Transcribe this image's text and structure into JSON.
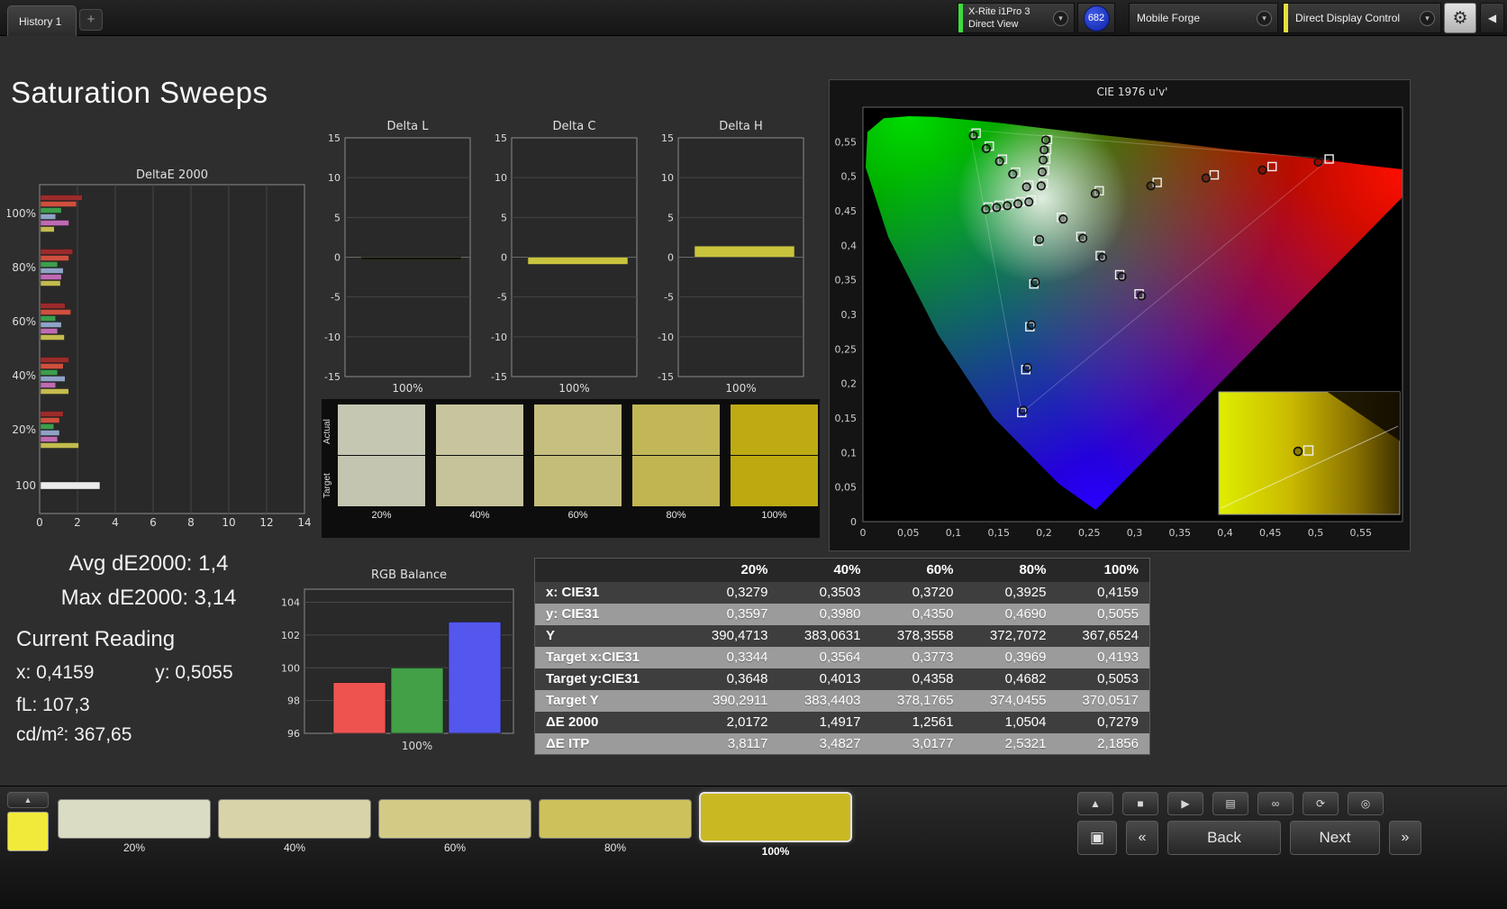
{
  "topbar": {
    "tab": "History 1",
    "add_tab": "+",
    "meter_device": {
      "line1": "X-Rite i1Pro 3",
      "line2": "Direct View",
      "accent": "#3ddc3d"
    },
    "reading_count": "682",
    "source_device": "Mobile Forge",
    "control_device": {
      "label": "Direct Display Control",
      "accent": "#e6e03c"
    },
    "gear_icon": "⚙",
    "collapse_icon": "◀"
  },
  "page_title": "Saturation Sweeps",
  "stats": {
    "avg": "Avg dE2000: 1,4",
    "max": "Max dE2000: 3,14",
    "current_reading": "Current Reading",
    "x": "x: 0,4159",
    "y": "y: 0,5055",
    "fl": "fL: 107,3",
    "luminance": "cd/m²: 367,65"
  },
  "swatch_strip": {
    "row_labels": [
      "Actual",
      "Target"
    ],
    "columns": [
      {
        "label": "20%",
        "actual": "#c6c7b3",
        "target": "#c4c5b0"
      },
      {
        "label": "40%",
        "actual": "#c8c59e",
        "target": "#c6c39a"
      },
      {
        "label": "60%",
        "actual": "#c6bf7f",
        "target": "#c4bd7a"
      },
      {
        "label": "80%",
        "actual": "#c2b757",
        "target": "#c0b551"
      },
      {
        "label": "100%",
        "actual": "#beab14",
        "target": "#bcaa10"
      }
    ]
  },
  "table": {
    "columns": [
      "20%",
      "40%",
      "60%",
      "80%",
      "100%"
    ],
    "rows": [
      {
        "label": "x: CIE31",
        "values": [
          "0,3279",
          "0,3503",
          "0,3720",
          "0,3925",
          "0,4159"
        ]
      },
      {
        "label": "y: CIE31",
        "values": [
          "0,3597",
          "0,3980",
          "0,4350",
          "0,4690",
          "0,5055"
        ]
      },
      {
        "label": "Y",
        "values": [
          "390,4713",
          "383,0631",
          "378,3558",
          "372,7072",
          "367,6524"
        ]
      },
      {
        "label": "Target x:CIE31",
        "values": [
          "0,3344",
          "0,3564",
          "0,3773",
          "0,3969",
          "0,4193"
        ]
      },
      {
        "label": "Target y:CIE31",
        "values": [
          "0,3648",
          "0,4013",
          "0,4358",
          "0,4682",
          "0,5053"
        ]
      },
      {
        "label": "Target Y",
        "values": [
          "390,2911",
          "383,4403",
          "378,1765",
          "374,0455",
          "370,0517"
        ]
      },
      {
        "label": "ΔE 2000",
        "values": [
          "2,0172",
          "1,4917",
          "1,2561",
          "1,0504",
          "0,7279"
        ]
      },
      {
        "label": "ΔE ITP",
        "values": [
          "3,8117",
          "3,4827",
          "3,0177",
          "2,5321",
          "2,1856"
        ]
      }
    ]
  },
  "bottombar": {
    "color_button": "#f2ea3a",
    "up_icon": "▲",
    "swatches": [
      {
        "label": "20%",
        "color": "#dadcc3",
        "selected": false
      },
      {
        "label": "40%",
        "color": "#d8d4a7",
        "selected": false
      },
      {
        "label": "60%",
        "color": "#d3cb85",
        "selected": false
      },
      {
        "label": "80%",
        "color": "#cdc15b",
        "selected": false
      },
      {
        "label": "100%",
        "color": "#cab823",
        "selected": true
      }
    ],
    "transport": [
      {
        "name": "stop",
        "icon": "■"
      },
      {
        "name": "play",
        "icon": "▶"
      },
      {
        "name": "readings-view",
        "icon": "▤"
      },
      {
        "name": "continuous-read",
        "icon": "∞"
      },
      {
        "name": "repeat",
        "icon": "⟳"
      },
      {
        "name": "capture",
        "icon": "◎"
      }
    ],
    "frame_icon": "▣",
    "back_chevron": "«",
    "back": "Back",
    "next": "Next",
    "next_chevron": "»"
  },
  "chart_data": [
    {
      "id": "deltae2000",
      "type": "bar",
      "orientation": "horizontal",
      "title": "DeltaE 2000",
      "xlim": [
        0,
        14
      ],
      "xticks": [
        0,
        2,
        4,
        6,
        8,
        10,
        12,
        14
      ],
      "groups": [
        {
          "label": "100%",
          "bars": [
            {
              "color": "#9c2b2b",
              "value": 2.2
            },
            {
              "color": "#cf4f3e",
              "value": 1.9
            },
            {
              "color": "#3c9e4d",
              "value": 1.1
            },
            {
              "color": "#8fa3c7",
              "value": 0.8
            },
            {
              "color": "#c06ab4",
              "value": 1.5
            },
            {
              "color": "#c3bb4e",
              "value": 0.73
            }
          ]
        },
        {
          "label": "80%",
          "bars": [
            {
              "color": "#9c2b2b",
              "value": 1.7
            },
            {
              "color": "#cf4f3e",
              "value": 1.5
            },
            {
              "color": "#3c9e4d",
              "value": 0.9
            },
            {
              "color": "#8fa3c7",
              "value": 1.2
            },
            {
              "color": "#c06ab4",
              "value": 1.1
            },
            {
              "color": "#c3bb4e",
              "value": 1.05
            }
          ]
        },
        {
          "label": "60%",
          "bars": [
            {
              "color": "#9c2b2b",
              "value": 1.3
            },
            {
              "color": "#cf4f3e",
              "value": 1.6
            },
            {
              "color": "#3c9e4d",
              "value": 0.8
            },
            {
              "color": "#8fa3c7",
              "value": 1.1
            },
            {
              "color": "#c06ab4",
              "value": 0.9
            },
            {
              "color": "#c3bb4e",
              "value": 1.26
            }
          ]
        },
        {
          "label": "40%",
          "bars": [
            {
              "color": "#9c2b2b",
              "value": 1.5
            },
            {
              "color": "#cf4f3e",
              "value": 1.2
            },
            {
              "color": "#3c9e4d",
              "value": 0.9
            },
            {
              "color": "#8fa3c7",
              "value": 1.3
            },
            {
              "color": "#c06ab4",
              "value": 0.8
            },
            {
              "color": "#c3bb4e",
              "value": 1.49
            }
          ]
        },
        {
          "label": "20%",
          "bars": [
            {
              "color": "#9c2b2b",
              "value": 1.2
            },
            {
              "color": "#cf4f3e",
              "value": 1.0
            },
            {
              "color": "#3c9e4d",
              "value": 0.7
            },
            {
              "color": "#8fa3c7",
              "value": 1.0
            },
            {
              "color": "#c06ab4",
              "value": 0.9
            },
            {
              "color": "#c3bb4e",
              "value": 2.02
            }
          ]
        },
        {
          "label": "100",
          "bars": [
            {
              "color": "#ececec",
              "value": 3.14
            }
          ]
        }
      ]
    },
    {
      "id": "delta_l",
      "type": "bar",
      "title": "Delta L",
      "ylim": [
        -15,
        15
      ],
      "yticks": [
        15,
        10,
        5,
        0,
        -5,
        -10,
        -15
      ],
      "categories": [
        "100%"
      ],
      "values": [
        -0.35
      ],
      "bar_color": "#14140a"
    },
    {
      "id": "delta_c",
      "type": "bar",
      "title": "Delta C",
      "ylim": [
        -15,
        15
      ],
      "yticks": [
        15,
        10,
        5,
        0,
        -5,
        -10,
        -15
      ],
      "categories": [
        "100%"
      ],
      "values": [
        -0.9
      ],
      "bar_color": "#c9c43d"
    },
    {
      "id": "delta_h",
      "type": "bar",
      "title": "Delta H",
      "ylim": [
        -15,
        15
      ],
      "yticks": [
        15,
        10,
        5,
        0,
        -5,
        -10,
        -15
      ],
      "categories": [
        "100%"
      ],
      "values": [
        1.4
      ],
      "bar_color": "#c9c43d"
    },
    {
      "id": "rgb_balance",
      "type": "bar",
      "title": "RGB Balance",
      "ylim": [
        96,
        104.8
      ],
      "yticks": [
        104,
        102,
        100,
        98,
        96
      ],
      "category": "100%",
      "series": [
        {
          "name": "red",
          "color": "#ee5350",
          "value": 99.1
        },
        {
          "name": "green",
          "color": "#43a047",
          "value": 100.0
        },
        {
          "name": "blue",
          "color": "#5457ee",
          "value": 102.8
        }
      ]
    },
    {
      "id": "cie",
      "type": "scatter",
      "title": "CIE 1976 u'v'",
      "xlim": [
        0,
        0.596
      ],
      "ylim": [
        0,
        0.6
      ],
      "ticks": [
        {
          "v": 0,
          "label": "0"
        },
        {
          "v": 0.05,
          "label": "0,05"
        },
        {
          "v": 0.1,
          "label": "0,1"
        },
        {
          "v": 0.15,
          "label": "0,15"
        },
        {
          "v": 0.2,
          "label": "0,2"
        },
        {
          "v": 0.25,
          "label": "0,25"
        },
        {
          "v": 0.3,
          "label": "0,3"
        },
        {
          "v": 0.35,
          "label": "0,35"
        },
        {
          "v": 0.4,
          "label": "0,4"
        },
        {
          "v": 0.45,
          "label": "0,45"
        },
        {
          "v": 0.5,
          "label": "0,5"
        },
        {
          "v": 0.55,
          "label": "0,55"
        }
      ],
      "locus": [
        [
          0.257,
          0.017
        ],
        [
          0.216,
          0.055
        ],
        [
          0.144,
          0.151
        ],
        [
          0.083,
          0.271
        ],
        [
          0.028,
          0.412
        ],
        [
          0.003,
          0.513
        ],
        [
          0.005,
          0.564
        ],
        [
          0.023,
          0.584
        ],
        [
          0.05,
          0.587
        ],
        [
          0.079,
          0.586
        ],
        [
          0.113,
          0.582
        ],
        [
          0.153,
          0.577
        ],
        [
          0.203,
          0.569
        ],
        [
          0.262,
          0.56
        ],
        [
          0.332,
          0.55
        ],
        [
          0.403,
          0.539
        ],
        [
          0.469,
          0.53
        ],
        [
          0.52,
          0.522
        ],
        [
          0.556,
          0.516
        ],
        [
          0.623,
          0.506
        ]
      ],
      "gamut": [
        [
          0.515,
          0.525
        ],
        [
          0.118,
          0.567
        ],
        [
          0.1754,
          0.1579
        ]
      ],
      "white_point": [
        0.1978,
        0.4683
      ],
      "targets": [
        [
          0.261,
          0.479
        ],
        [
          0.325,
          0.491
        ],
        [
          0.388,
          0.502
        ],
        [
          0.452,
          0.514
        ],
        [
          0.515,
          0.525
        ],
        [
          0.1832,
          0.4871
        ],
        [
          0.1687,
          0.506
        ],
        [
          0.1541,
          0.5248
        ],
        [
          0.1396,
          0.5437
        ],
        [
          0.125,
          0.5625
        ],
        [
          0.1933,
          0.4062
        ],
        [
          0.1888,
          0.3441
        ],
        [
          0.1844,
          0.2821
        ],
        [
          0.1799,
          0.22
        ],
        [
          0.1754,
          0.1579
        ],
        [
          0.1859,
          0.4657
        ],
        [
          0.174,
          0.4631
        ],
        [
          0.1622,
          0.4606
        ],
        [
          0.1503,
          0.458
        ],
        [
          0.1384,
          0.4554
        ],
        [
          0.2192,
          0.4406
        ],
        [
          0.2407,
          0.4129
        ],
        [
          0.2621,
          0.3852
        ],
        [
          0.2836,
          0.3575
        ],
        [
          0.305,
          0.3298
        ],
        [
          0.1994,
          0.4894
        ],
        [
          0.2007,
          0.5085
        ],
        [
          0.2019,
          0.5247
        ],
        [
          0.2029,
          0.5385
        ],
        [
          0.2039,
          0.5529
        ]
      ],
      "measured": [
        [
          0.2566,
          0.4748
        ],
        [
          0.318,
          0.4861
        ],
        [
          0.3789,
          0.4975
        ],
        [
          0.4413,
          0.509
        ],
        [
          0.503,
          0.5205
        ],
        [
          0.1807,
          0.4846
        ],
        [
          0.1655,
          0.5031
        ],
        [
          0.1509,
          0.5216
        ],
        [
          0.1362,
          0.5402
        ],
        [
          0.1219,
          0.5588
        ],
        [
          0.1951,
          0.4085
        ],
        [
          0.1904,
          0.3468
        ],
        [
          0.1861,
          0.2848
        ],
        [
          0.1818,
          0.2231
        ],
        [
          0.1772,
          0.1612
        ],
        [
          0.1833,
          0.4629
        ],
        [
          0.1712,
          0.4601
        ],
        [
          0.1594,
          0.4574
        ],
        [
          0.1476,
          0.4547
        ],
        [
          0.1357,
          0.452
        ],
        [
          0.2212,
          0.4381
        ],
        [
          0.2429,
          0.4102
        ],
        [
          0.2645,
          0.3824
        ],
        [
          0.2861,
          0.3546
        ],
        [
          0.3077,
          0.3268
        ],
        [
          0.1969,
          0.486
        ],
        [
          0.198,
          0.5063
        ],
        [
          0.199,
          0.5236
        ],
        [
          0.2002,
          0.5382
        ],
        [
          0.202,
          0.5525
        ]
      ],
      "inset": {
        "circle": [
          0.4806,
          0.1017
        ],
        "square": [
          0.492,
          0.103
        ]
      }
    }
  ]
}
